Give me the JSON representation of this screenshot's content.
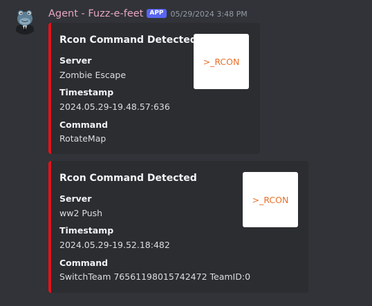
{
  "message": {
    "username": "Agent - Fuzz-e-feet",
    "badge": "APP",
    "timestamp": "05/29/2024 3:48 PM",
    "avatar_icon": "frog-in-suit-avatar-icon"
  },
  "embeds": [
    {
      "title": "Rcon Command Detected",
      "accent_color": "#e3121a",
      "thumbnail_text": ">_RCON",
      "fields": [
        {
          "name": "Server",
          "value": "Zombie Escape"
        },
        {
          "name": "Timestamp",
          "value": "2024.05.29-19.48.57:636"
        },
        {
          "name": "Command",
          "value": "RotateMap"
        }
      ]
    },
    {
      "title": "Rcon Command Detected",
      "accent_color": "#e3121a",
      "thumbnail_text": ">_RCON",
      "fields": [
        {
          "name": "Server",
          "value": "ww2 Push"
        },
        {
          "name": "Timestamp",
          "value": "2024.05.29-19.52.18:482"
        },
        {
          "name": "Command",
          "value": "SwitchTeam 76561198015742472 TeamID:0"
        }
      ]
    }
  ]
}
